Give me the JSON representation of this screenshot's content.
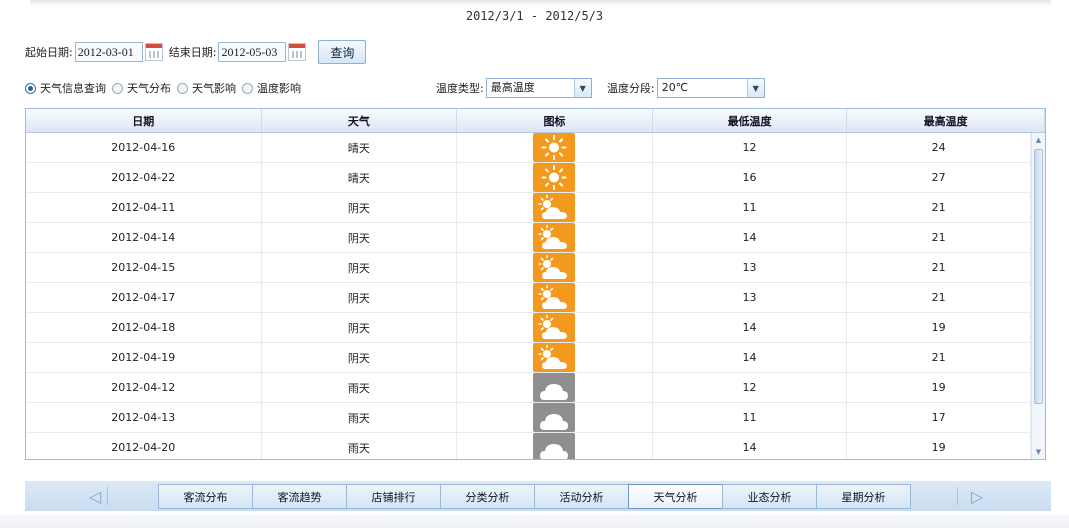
{
  "header": {
    "range_title": "2012/3/1 - 2012/5/3"
  },
  "query": {
    "start_label": "起始日期:",
    "start_value": "2012-03-01",
    "end_label": "结束日期:",
    "end_value": "2012-05-03",
    "submit_label": "查询"
  },
  "filters": {
    "radios": [
      {
        "label": "天气信息查询",
        "checked": true
      },
      {
        "label": "天气分布",
        "checked": false
      },
      {
        "label": "天气影响",
        "checked": false
      },
      {
        "label": "温度影响",
        "checked": false
      }
    ],
    "temp_type_label": "温度类型:",
    "temp_type_value": "最高温度",
    "temp_segment_label": "温度分段:",
    "temp_segment_value": "20℃"
  },
  "table": {
    "columns": [
      "日期",
      "天气",
      "图标",
      "最低温度",
      "最高温度"
    ],
    "rows": [
      {
        "date": "2012-04-16",
        "weather": "晴天",
        "icon": "sunny-icon",
        "low": "12",
        "high": "24"
      },
      {
        "date": "2012-04-22",
        "weather": "晴天",
        "icon": "sunny-icon",
        "low": "16",
        "high": "27"
      },
      {
        "date": "2012-04-11",
        "weather": "阴天",
        "icon": "partly-cloudy-icon",
        "low": "11",
        "high": "21"
      },
      {
        "date": "2012-04-14",
        "weather": "阴天",
        "icon": "partly-cloudy-icon",
        "low": "14",
        "high": "21"
      },
      {
        "date": "2012-04-15",
        "weather": "阴天",
        "icon": "partly-cloudy-icon",
        "low": "13",
        "high": "21"
      },
      {
        "date": "2012-04-17",
        "weather": "阴天",
        "icon": "partly-cloudy-icon",
        "low": "13",
        "high": "21"
      },
      {
        "date": "2012-04-18",
        "weather": "阴天",
        "icon": "partly-cloudy-icon",
        "low": "14",
        "high": "19"
      },
      {
        "date": "2012-04-19",
        "weather": "阴天",
        "icon": "partly-cloudy-icon",
        "low": "14",
        "high": "21"
      },
      {
        "date": "2012-04-12",
        "weather": "雨天",
        "icon": "cloud-icon",
        "low": "12",
        "high": "19"
      },
      {
        "date": "2012-04-13",
        "weather": "雨天",
        "icon": "cloud-icon",
        "low": "11",
        "high": "17"
      },
      {
        "date": "2012-04-20",
        "weather": "雨天",
        "icon": "cloud-icon",
        "low": "14",
        "high": "19"
      }
    ]
  },
  "tabs": {
    "items": [
      "客流分布",
      "客流趋势",
      "店铺排行",
      "分类分析",
      "活动分析",
      "天气分析",
      "业态分析",
      "星期分析"
    ],
    "active_index": 5
  },
  "colors": {
    "accent": "#99bbe8",
    "sun_icon_bg": "#f39a1e",
    "rain_icon_bg": "#8f8f8f"
  }
}
